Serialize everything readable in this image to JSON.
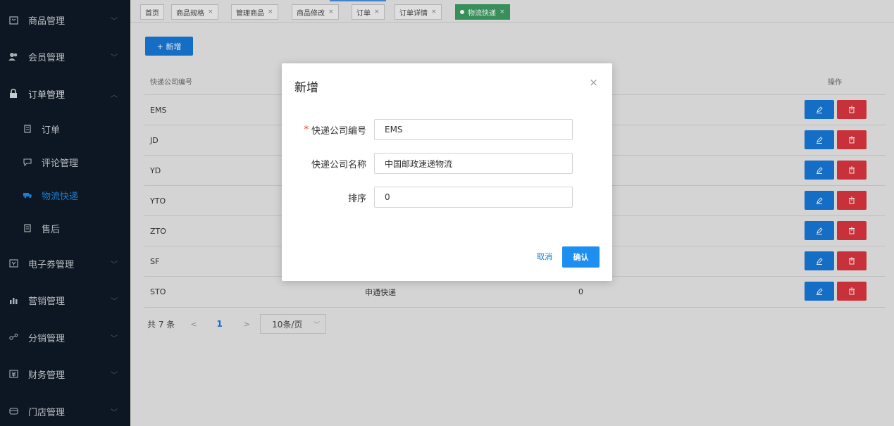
{
  "sidebar": {
    "items": [
      {
        "label": "商品管理",
        "icon": "bag-icon",
        "arrow": "﹀"
      },
      {
        "label": "会员管理",
        "icon": "users-icon",
        "arrow": "﹀"
      },
      {
        "label": "订单管理",
        "icon": "lock-icon",
        "arrow": "︿"
      },
      {
        "label": "订单",
        "icon": "document-icon"
      },
      {
        "label": "评论管理",
        "icon": "comment-icon"
      },
      {
        "label": "物流快递",
        "icon": "truck-icon"
      },
      {
        "label": "售后",
        "icon": "document-icon"
      },
      {
        "label": "电子券管理",
        "icon": "ticket-icon",
        "arrow": "﹀"
      },
      {
        "label": "营销管理",
        "icon": "chart-icon",
        "arrow": "﹀"
      },
      {
        "label": "分销管理",
        "icon": "share-icon",
        "arrow": "﹀"
      },
      {
        "label": "财务管理",
        "icon": "finance-icon",
        "arrow": "﹀"
      },
      {
        "label": "门店管理",
        "icon": "store-icon",
        "arrow": "﹀"
      }
    ]
  },
  "tabs": [
    {
      "label": "首页",
      "close": ""
    },
    {
      "label": "商品规格",
      "close": "×"
    },
    {
      "label": "管理商品",
      "close": "×"
    },
    {
      "label": "商品修改",
      "close": "×"
    },
    {
      "label": "订单",
      "close": "×"
    },
    {
      "label": "订单详情",
      "close": "×"
    },
    {
      "label": "物流快递",
      "close": "×"
    }
  ],
  "toolbar": {
    "add_label": "+ 新增"
  },
  "table": {
    "headers": {
      "code": "快递公司编号",
      "operation": "操作"
    },
    "rows": [
      {
        "code": "EMS",
        "name": "",
        "sort": ""
      },
      {
        "code": "JD",
        "name": "",
        "sort": ""
      },
      {
        "code": "YD",
        "name": "",
        "sort": ""
      },
      {
        "code": "YTO",
        "name": "",
        "sort": ""
      },
      {
        "code": "ZTO",
        "name": "",
        "sort": ""
      },
      {
        "code": "SF",
        "name": "",
        "sort": ""
      },
      {
        "code": "STO",
        "name": "申通快递",
        "sort": "0"
      }
    ]
  },
  "pagination": {
    "total": "共 7 条",
    "prev": "<",
    "current": "1",
    "next": ">",
    "page_size": "10条/页",
    "size_caret": "﹀"
  },
  "modal": {
    "title": "新增",
    "close": "×",
    "fields": {
      "code_required": "*",
      "code_label": "快递公司编号",
      "code_value": "EMS",
      "name_label": "快递公司名称",
      "name_value": "中国邮政速递物流",
      "sort_label": "排序",
      "sort_value": "0"
    },
    "cancel_label": "取消",
    "ok_label": "确认"
  },
  "colors": {
    "sidebar_bg": "#0e1a26",
    "primary": "#1678d6",
    "danger": "#d9363e",
    "active_tab": "#3e9c62"
  }
}
